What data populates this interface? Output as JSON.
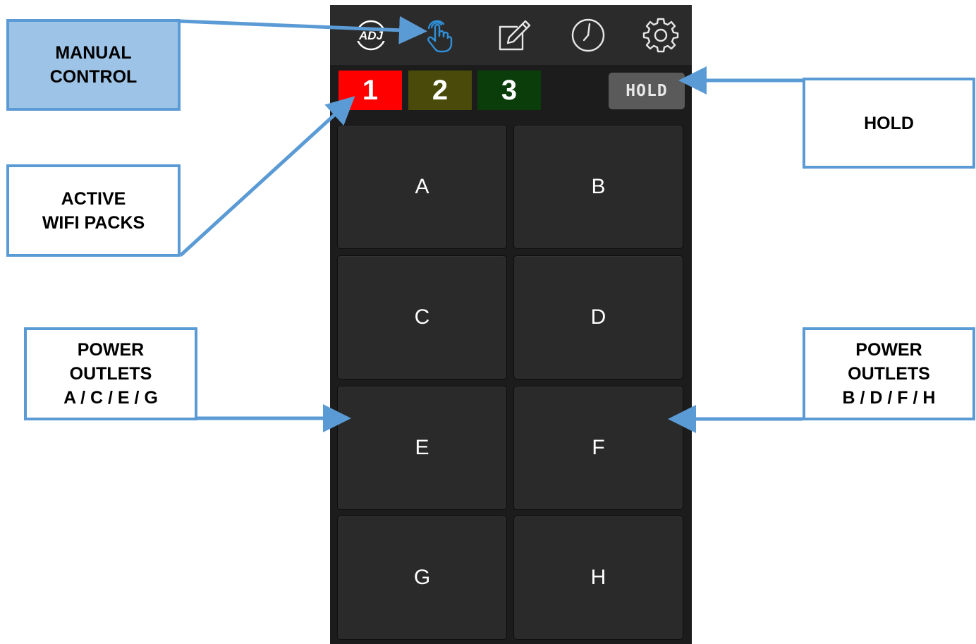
{
  "callouts": {
    "manual_control": "MANUAL\nCONTROL",
    "active_wifi_packs": "ACTIVE\nWIFI PACKS",
    "outlets_left": "POWER\nOUTLETS\nA / C / E / G",
    "hold": "HOLD",
    "outlets_right": "POWER\nOUTLETS\nB / D / F / H"
  },
  "topbar": {
    "icons": [
      "adj-logo-icon",
      "touch-hand-icon",
      "edit-icon",
      "clock-icon",
      "gear-icon"
    ],
    "active_icon": "touch-hand-icon",
    "logo_text": "ADJ"
  },
  "packs": [
    {
      "label": "1",
      "color": "#ff0000"
    },
    {
      "label": "2",
      "color": "#4a4a0a"
    },
    {
      "label": "3",
      "color": "#0a3d0a"
    }
  ],
  "hold_label": "HOLD",
  "outlets": [
    "A",
    "B",
    "C",
    "D",
    "E",
    "F",
    "G",
    "H"
  ],
  "colors": {
    "accent": "#5b9bd5",
    "active_icon": "#2f8fd8",
    "phone_bg": "#1c1c1c",
    "button_bg": "#2a2a2a",
    "hold_bg": "#5a5a5a"
  }
}
